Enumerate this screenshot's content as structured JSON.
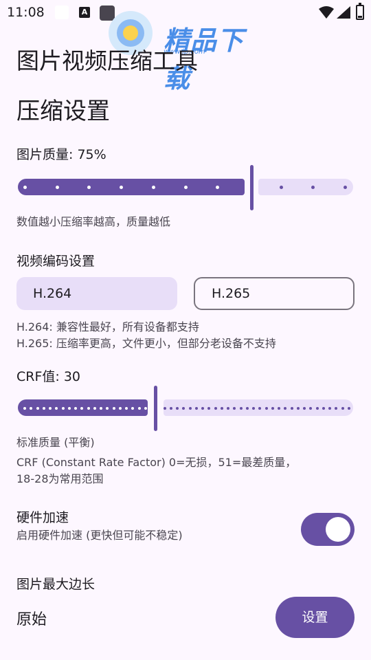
{
  "status_bar": {
    "time": "11:08",
    "icons": [
      "white-square-icon",
      "a-icon",
      "dark-square-icon",
      "wifi-icon",
      "signal-icon",
      "battery-icon"
    ],
    "a_icon_letter": "A"
  },
  "watermark": {
    "text": "精品下载",
    "url": "www.jp.com"
  },
  "app": {
    "title": "图片视频压缩工具"
  },
  "settings": {
    "section_title": "压缩设置",
    "image_quality": {
      "label": "图片质量: 75%",
      "value_percent": 75,
      "hint": "数值越小压缩率越高，质量越低"
    },
    "video_codec": {
      "label": "视频编码设置",
      "options": [
        "H.264",
        "H.265"
      ],
      "selected": "H.264",
      "hint_h264": "H.264: 兼容性最好，所有设备都支持",
      "hint_h265": "H.265: 压缩率更高，文件更小，但部分老设备不支持"
    },
    "crf": {
      "label": "CRF值: 30",
      "value": 30,
      "min": 0,
      "max": 51,
      "quality_text": "标准质量 (平衡)",
      "hint_line1": "CRF (Constant Rate Factor) 0=无损，51=最差质量，",
      "hint_line2": "18-28为常用范围"
    },
    "hardware_accel": {
      "label": "硬件加速",
      "description": "启用硬件加速 (更快但可能不稳定)",
      "enabled": true
    },
    "max_edge": {
      "label": "图片最大边长",
      "value": "原始",
      "button_label": "设置"
    }
  },
  "colors": {
    "primary": "#6750a4",
    "secondary_container": "#e8def8",
    "background": "#fdf7ff"
  }
}
